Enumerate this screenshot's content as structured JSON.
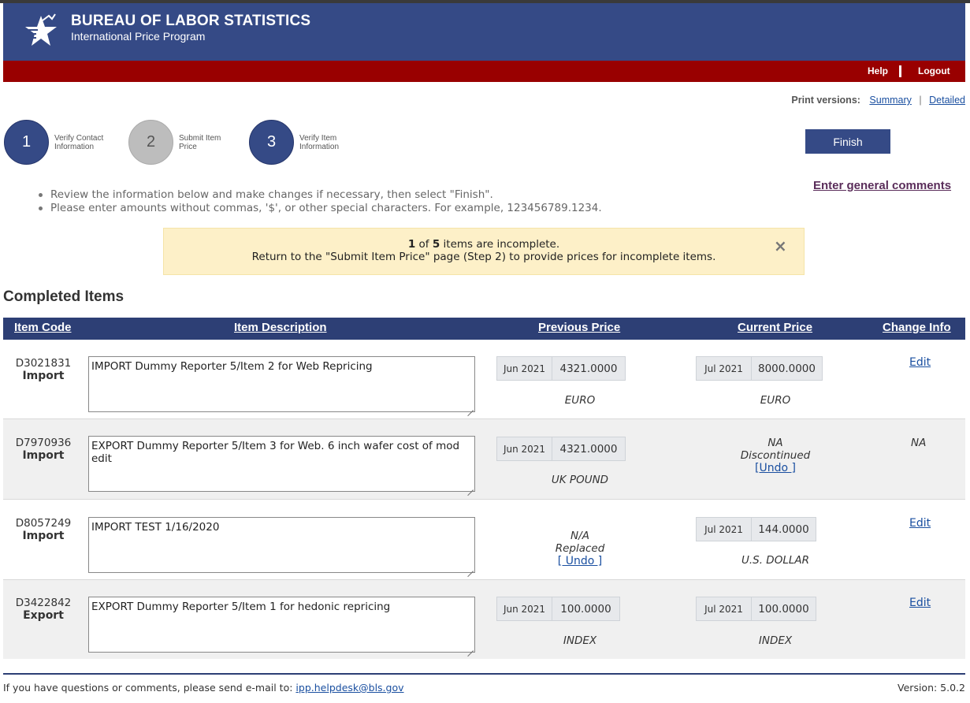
{
  "header": {
    "title": "BUREAU OF LABOR STATISTICS",
    "subtitle": "International Price Program",
    "help": "Help",
    "logout": "Logout",
    "brand_color": "#354a86",
    "bar_color": "#990000"
  },
  "print_versions": {
    "label": "Print versions:",
    "summary": "Summary",
    "detailed": "Detailed"
  },
  "steps": [
    {
      "number": "1",
      "label": "Verify Contact Information",
      "state": "active"
    },
    {
      "number": "2",
      "label": "Submit Item Price",
      "state": "inactive"
    },
    {
      "number": "3",
      "label": "Verify Item Information",
      "state": "active"
    }
  ],
  "finish_label": "Finish",
  "general_comments": "Enter general comments",
  "instructions": [
    "Review the information below and make changes if necessary, then select \"Finish\".",
    "Please enter amounts without commas, '$', or other special characters. For example, 123456789.1234."
  ],
  "alert": {
    "count": "1",
    "of": "of",
    "total": "5",
    "suffix": "items are incomplete.",
    "line2": "Return to the \"Submit Item Price\" page (Step 2) to provide prices for incomplete items.",
    "close": "×"
  },
  "completed_title": "Completed Items",
  "table": {
    "headers": {
      "code": "Item Code",
      "description": "Item Description",
      "previous": "Previous Price",
      "current": "Current Price",
      "change": "Change Info"
    },
    "rows": [
      {
        "code": "D3021831",
        "type": "Import",
        "description": "IMPORT Dummy Reporter 5/Item 2 for Web Repricing",
        "prev_date": "Jun 2021",
        "prev_value": "4321.0000",
        "prev_currency": "EURO",
        "cur_date": "Jul 2021",
        "cur_value": "8000.0000",
        "cur_currency": "EURO",
        "change": "Edit"
      },
      {
        "code": "D7970936",
        "type": "Import",
        "description": "EXPORT Dummy Reporter 5/Item 3 for Web. 6 inch wafer cost of mod edit",
        "prev_date": "Jun 2021",
        "prev_value": "4321.0000",
        "prev_currency": "UK POUND",
        "cur_status": "NA",
        "cur_status2": "Discontinued",
        "cur_undo": "[Undo ]",
        "change": "NA"
      },
      {
        "code": "D8057249",
        "type": "Import",
        "description": "IMPORT TEST 1/16/2020",
        "prev_status": "N/A",
        "prev_status2": "Replaced",
        "prev_undo": "[ Undo ]",
        "cur_date": "Jul 2021",
        "cur_value": "144.0000",
        "cur_currency": "U.S. DOLLAR",
        "change": "Edit"
      },
      {
        "code": "D3422842",
        "type": "Export",
        "description": "EXPORT Dummy Reporter  5/Item 1 for hedonic repricing",
        "prev_date": "Jun 2021",
        "prev_value": "100.0000",
        "prev_currency": "INDEX",
        "cur_date": "Jul 2021",
        "cur_value": "100.0000",
        "cur_currency": "INDEX",
        "change": "Edit"
      }
    ]
  },
  "footer": {
    "text": "If you have questions or comments, please send e-mail to:",
    "email": "ipp.helpdesk@bls.gov",
    "version": "Version: 5.0.2"
  }
}
